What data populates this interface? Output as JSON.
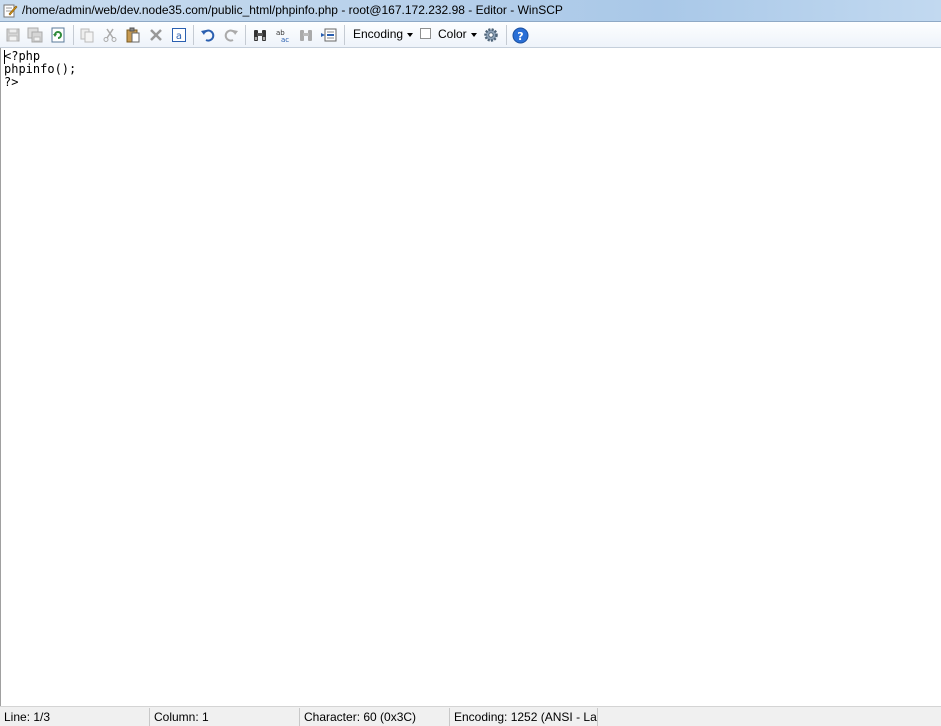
{
  "window": {
    "title": "/home/admin/web/dev.node35.com/public_html/phpinfo.php - root@167.172.232.98 - Editor - WinSCP"
  },
  "toolbar": {
    "buttons": [
      {
        "icon": "save-icon",
        "enabled": false
      },
      {
        "icon": "save-all-icon",
        "enabled": false
      },
      {
        "icon": "reload-icon",
        "enabled": true
      },
      {
        "icon": "copy-icon",
        "enabled": false
      },
      {
        "icon": "cut-icon",
        "enabled": false
      },
      {
        "icon": "paste-icon",
        "enabled": true
      },
      {
        "icon": "delete-icon",
        "enabled": false
      },
      {
        "icon": "select-all-icon",
        "enabled": true
      },
      {
        "icon": "undo-icon",
        "enabled": true
      },
      {
        "icon": "redo-icon",
        "enabled": false
      },
      {
        "icon": "find-icon",
        "enabled": true
      },
      {
        "icon": "replace-icon",
        "enabled": true
      },
      {
        "icon": "find-next-icon",
        "enabled": false
      },
      {
        "icon": "go-to-line-icon",
        "enabled": true
      },
      {
        "icon": "preferences-icon",
        "enabled": true
      },
      {
        "icon": "help-icon",
        "enabled": true
      }
    ],
    "encoding_label": "Encoding",
    "color_label": "Color",
    "color_checked": false
  },
  "editor": {
    "lines": [
      "<?php",
      "phpinfo();",
      "?>"
    ]
  },
  "status": {
    "line": "Line: 1/3",
    "column": "Column: 1",
    "character": "Character: 60 (0x3C)",
    "encoding": "Encoding: 1252  (ANSI - La"
  },
  "colors": {
    "help_blue": "#2a6fd6",
    "reload_green": "#2e8b3a",
    "undo_blue": "#2a5fb0"
  }
}
